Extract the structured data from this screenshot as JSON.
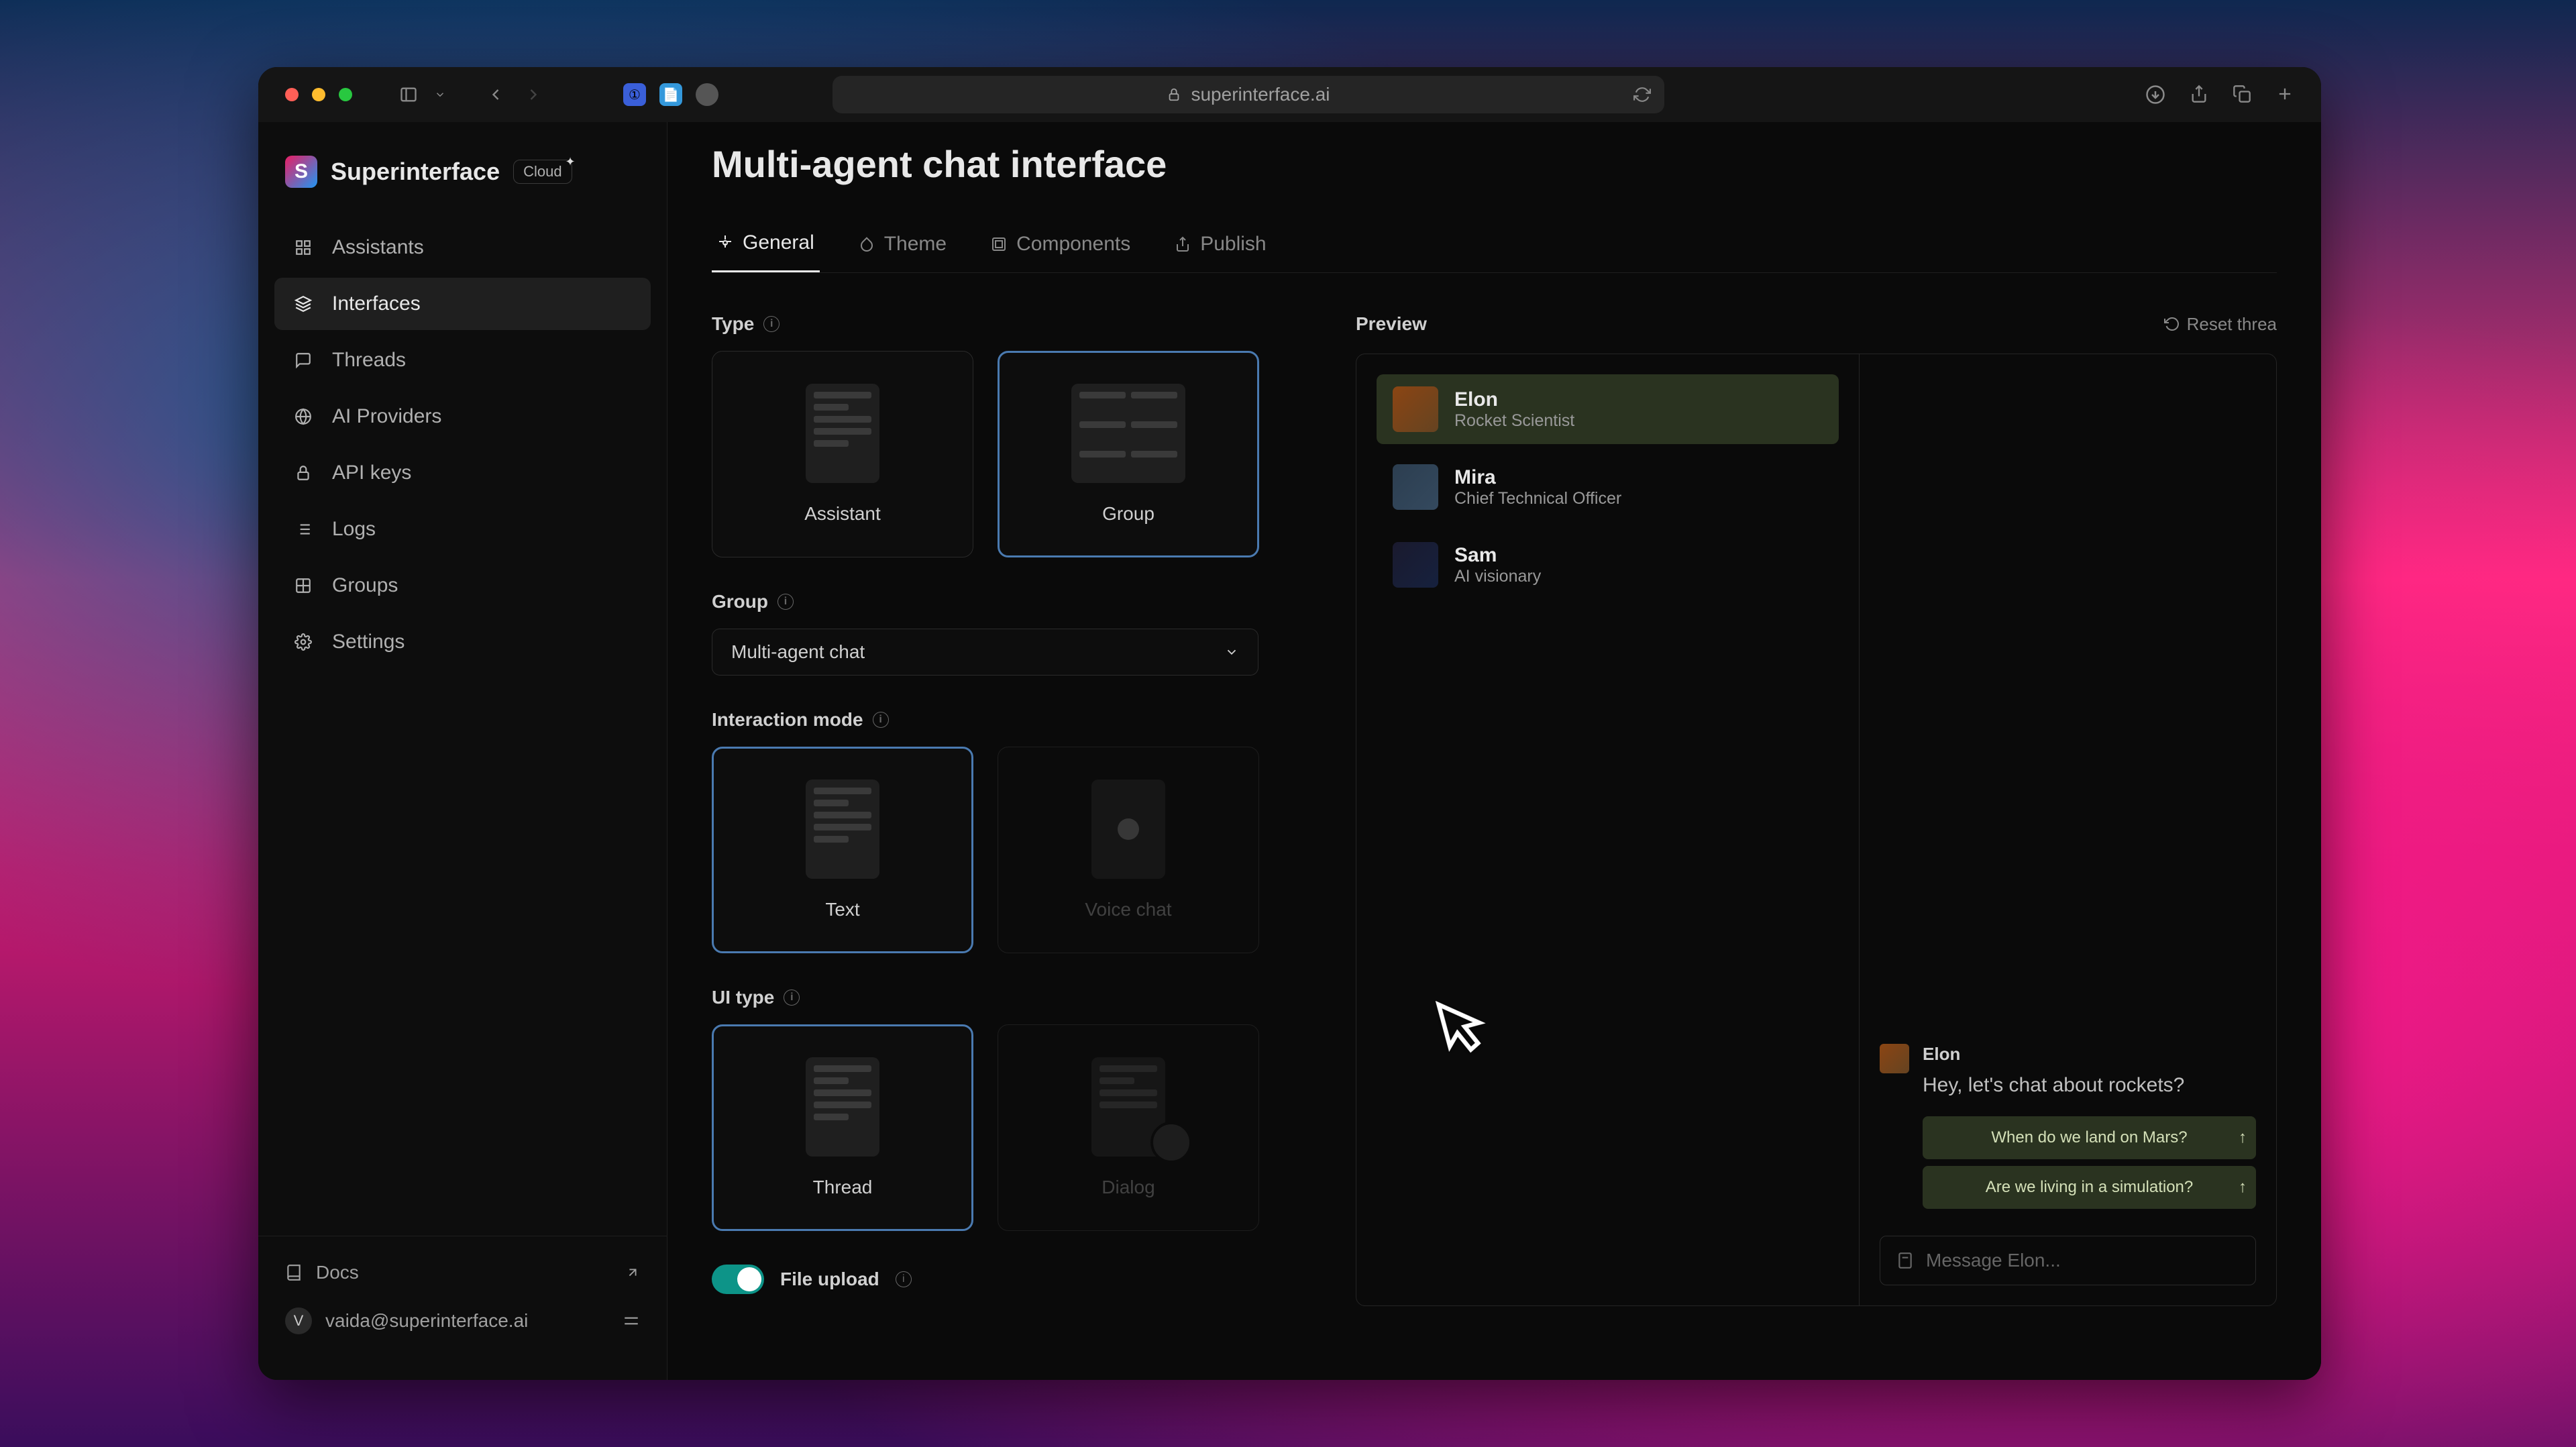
{
  "browser": {
    "url": "superinterface.ai"
  },
  "brand": {
    "name": "Superinterface",
    "badge": "Cloud"
  },
  "sidebar": {
    "items": [
      {
        "label": "Assistants",
        "icon": "apps"
      },
      {
        "label": "Interfaces",
        "icon": "layers"
      },
      {
        "label": "Threads",
        "icon": "chat"
      },
      {
        "label": "AI Providers",
        "icon": "globe"
      },
      {
        "label": "API keys",
        "icon": "lock"
      },
      {
        "label": "Logs",
        "icon": "list"
      },
      {
        "label": "Groups",
        "icon": "grid"
      },
      {
        "label": "Settings",
        "icon": "gear"
      }
    ],
    "docs": "Docs",
    "user": "vaida@superinterface.ai",
    "userInitial": "V"
  },
  "page": {
    "title": "Multi-agent chat interface"
  },
  "tabs": [
    {
      "label": "General",
      "icon": "settings"
    },
    {
      "label": "Theme",
      "icon": "drop"
    },
    {
      "label": "Components",
      "icon": "box"
    },
    {
      "label": "Publish",
      "icon": "upload"
    }
  ],
  "config": {
    "typeLabel": "Type",
    "typeOptions": [
      {
        "label": "Assistant"
      },
      {
        "label": "Group"
      }
    ],
    "groupLabel": "Group",
    "groupValue": "Multi-agent chat",
    "interactionLabel": "Interaction mode",
    "interactionOptions": [
      {
        "label": "Text"
      },
      {
        "label": "Voice chat"
      }
    ],
    "uiTypeLabel": "UI type",
    "uiTypeOptions": [
      {
        "label": "Thread"
      },
      {
        "label": "Dialog"
      }
    ],
    "fileUploadLabel": "File upload"
  },
  "preview": {
    "label": "Preview",
    "resetLabel": "Reset threa",
    "agents": [
      {
        "name": "Elon",
        "title": "Rocket Scientist"
      },
      {
        "name": "Mira",
        "title": "Chief Technical Officer"
      },
      {
        "name": "Sam",
        "title": "AI visionary"
      }
    ],
    "message": {
      "author": "Elon",
      "text": "Hey, let's chat about rockets?"
    },
    "suggestions": [
      "When do we land on Mars?",
      "Are we living in a simulation?"
    ],
    "inputPlaceholder": "Message Elon..."
  }
}
